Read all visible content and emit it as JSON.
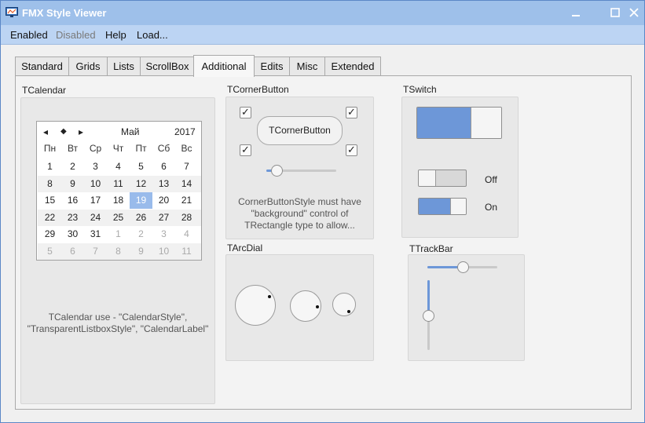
{
  "window": {
    "title": "FMX Style Viewer"
  },
  "menu": [
    "Enabled",
    "Disabled",
    "Help",
    "Load..."
  ],
  "tabs": [
    "Standard",
    "Grids",
    "Lists",
    "ScrollBox",
    "Additional",
    "Edits",
    "Misc",
    "Extended"
  ],
  "active_tab": "Additional",
  "calendar": {
    "label": "TCalendar",
    "nav_prev": "◂",
    "nav_today": "◆",
    "nav_next": "▸",
    "month": "Май",
    "year": "2017",
    "weekdays": [
      "Пн",
      "Вт",
      "Ср",
      "Чт",
      "Пт",
      "Сб",
      "Вс"
    ],
    "rows": [
      [
        "1",
        "2",
        "3",
        "4",
        "5",
        "6",
        "7"
      ],
      [
        "8",
        "9",
        "10",
        "11",
        "12",
        "13",
        "14"
      ],
      [
        "15",
        "16",
        "17",
        "18",
        "19",
        "20",
        "21"
      ],
      [
        "22",
        "23",
        "24",
        "25",
        "26",
        "27",
        "28"
      ],
      [
        "29",
        "30",
        "31",
        "1",
        "2",
        "3",
        "4"
      ],
      [
        "5",
        "6",
        "7",
        "8",
        "9",
        "10",
        "11"
      ]
    ],
    "selected": "19",
    "description_1": "TCalendar use - \"CalendarStyle\",",
    "description_2": "\"TransparentListboxStyle\", \"CalendarLabel\""
  },
  "corner_button": {
    "label": "TCornerButton",
    "button_text": "TCornerButton",
    "checkmark": "✓",
    "trackbar_value": 0.15,
    "description_1": "CornerButtonStyle must have",
    "description_2": "\"background\" control of",
    "description_3": "TRectangle type to allow..."
  },
  "switch": {
    "label": "TSwitch",
    "big_switch_on": true,
    "off_label": "Off",
    "on_label": "On"
  },
  "arc_dial": {
    "label": "TArcDial"
  },
  "trackbar": {
    "label": "TTrackBar",
    "horizontal_value": 0.5,
    "vertical_value": 0.5
  },
  "colors": {
    "accent": "#6d97d8",
    "selected_day": "#99bbeb",
    "titlebar": "#9ec0ea",
    "menubar": "#bcd4f3"
  }
}
